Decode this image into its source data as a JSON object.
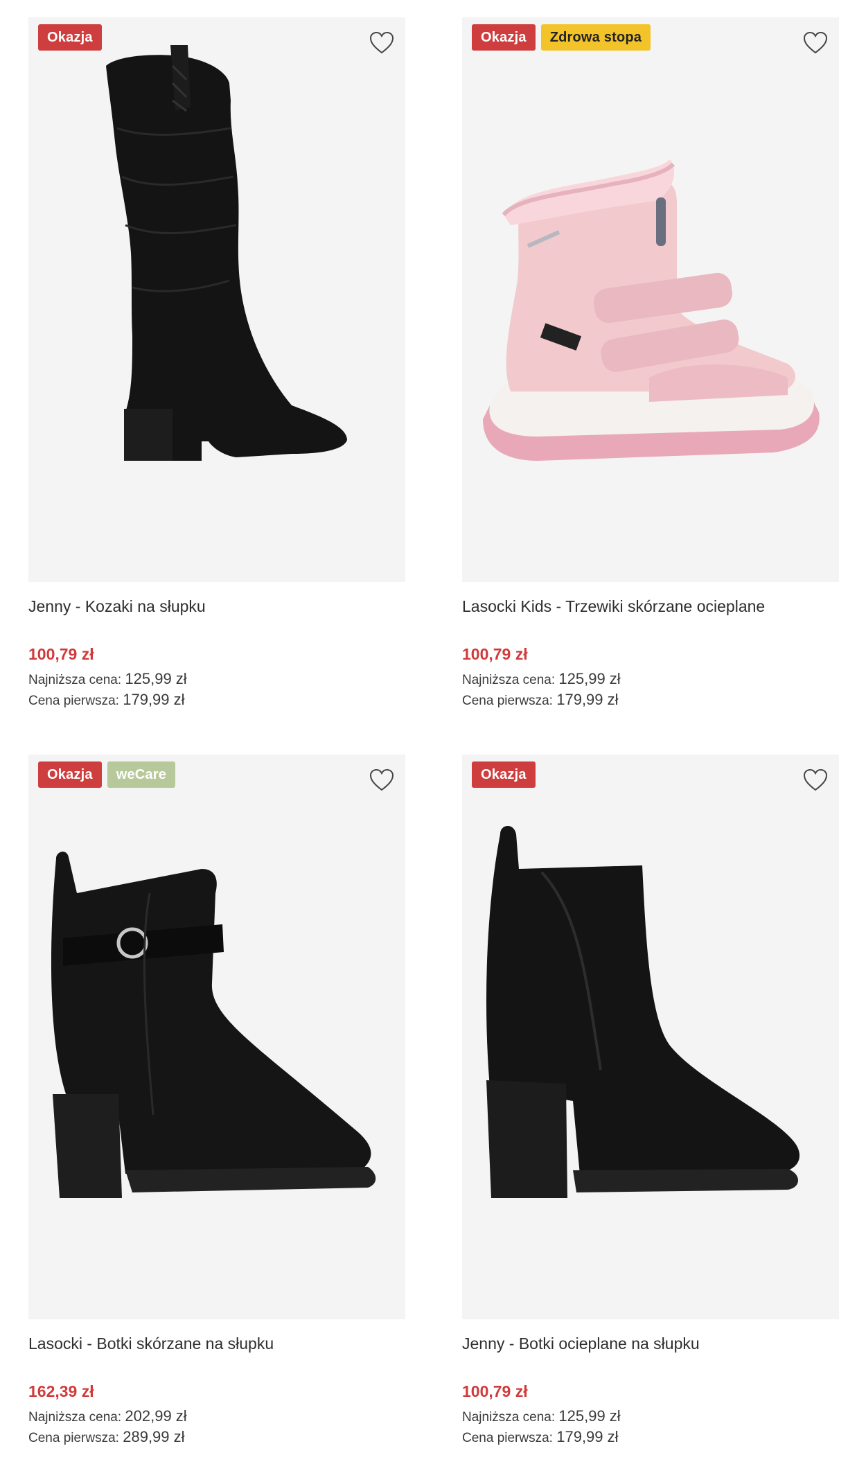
{
  "colors": {
    "badge_okazja": "#cf3e3e",
    "badge_zdrowa": "#f3c42a",
    "badge_wecare": "#b7c99a",
    "price_red": "#d13a3a",
    "image_bg": "#f4f4f4"
  },
  "products": [
    {
      "badges": [
        {
          "text": "Okazja",
          "style": "okazja"
        }
      ],
      "name": "Jenny - Kozaki na słupku",
      "price": "100,79 zł",
      "lowest_label": "Najniższa cena:",
      "lowest_value": "125,99 zł",
      "first_label": "Cena pierwsza:",
      "first_value": "179,99 zł",
      "image": "black-tall-suede-boot",
      "icon": "heart-icon"
    },
    {
      "badges": [
        {
          "text": "Okazja",
          "style": "okazja"
        },
        {
          "text": "Zdrowa stopa",
          "style": "zdrowa"
        }
      ],
      "name": "Lasocki Kids - Trzewiki skórzane ocieplane",
      "price": "100,79 zł",
      "lowest_label": "Najniższa cena:",
      "lowest_value": "125,99 zł",
      "first_label": "Cena pierwsza:",
      "first_value": "179,99 zł",
      "image": "pink-kids-snow-boot",
      "icon": "heart-icon"
    },
    {
      "badges": [
        {
          "text": "Okazja",
          "style": "okazja"
        },
        {
          "text": "weCare",
          "style": "wecare"
        }
      ],
      "name": "Lasocki - Botki skórzane na słupku",
      "price": "162,39 zł",
      "lowest_label": "Najniższa cena:",
      "lowest_value": "202,99 zł",
      "first_label": "Cena pierwsza:",
      "first_value": "289,99 zł",
      "image": "black-ankle-boot-strap",
      "icon": "heart-icon"
    },
    {
      "badges": [
        {
          "text": "Okazja",
          "style": "okazja"
        }
      ],
      "name": "Jenny - Botki ocieplane na słupku",
      "price": "100,79 zł",
      "lowest_label": "Najniższa cena:",
      "lowest_value": "125,99 zł",
      "first_label": "Cena pierwsza:",
      "first_value": "179,99 zł",
      "image": "black-ankle-boot-chelsea",
      "icon": "heart-icon"
    }
  ]
}
